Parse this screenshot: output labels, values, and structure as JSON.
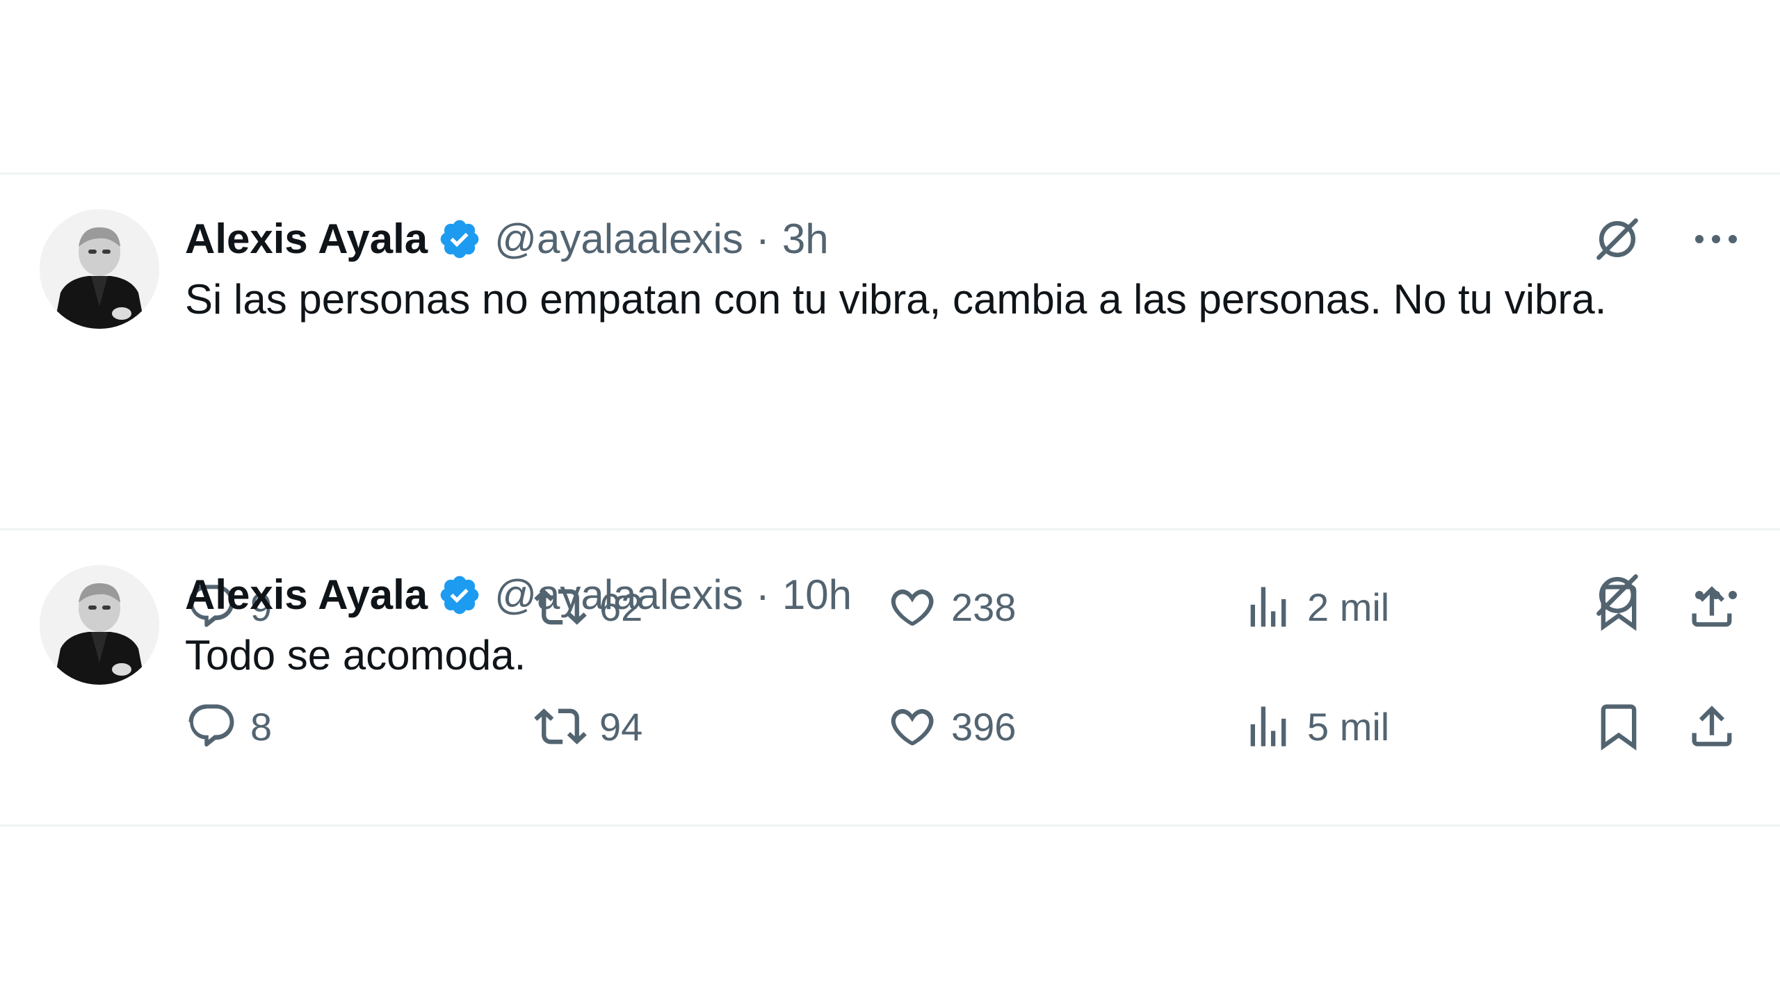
{
  "tweets": [
    {
      "display_name": "Alexis Ayala",
      "handle": "@ayalaalexis",
      "separator": "·",
      "time": "3h",
      "text": "Si las personas no empatan con tu vibra, cambia a las personas. No tu vibra.",
      "replies": "9",
      "retweets": "62",
      "likes": "238",
      "views": "2 mil"
    },
    {
      "display_name": "Alexis Ayala",
      "handle": "@ayalaalexis",
      "separator": "·",
      "time": "10h",
      "text": "Todo se acomoda.",
      "replies": "8",
      "retweets": "94",
      "likes": "396",
      "views": "5 mil"
    }
  ],
  "icons": {
    "verified": "verified-badge-icon",
    "grok": "grok-icon",
    "more": "more-icon",
    "reply": "reply-icon",
    "retweet": "retweet-icon",
    "like": "heart-icon",
    "views": "views-icon",
    "bookmark": "bookmark-icon",
    "share": "share-icon"
  },
  "colors": {
    "verified": "#1d9bf0",
    "text": "#0f1419",
    "secondary": "#536471",
    "divider": "#eff3f4"
  }
}
